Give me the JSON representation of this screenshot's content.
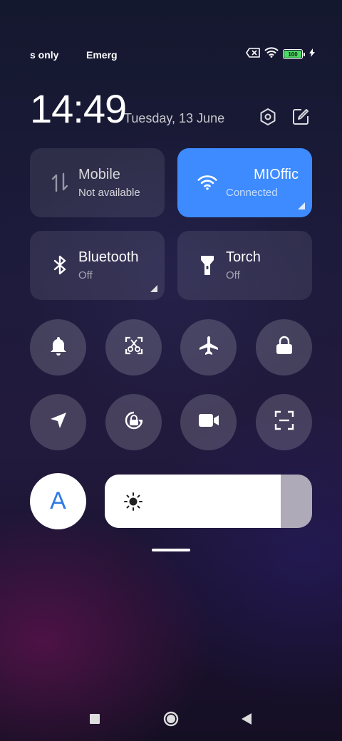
{
  "status_bar": {
    "carrier_left": "s only",
    "carrier_right": "Emerg",
    "battery_level": "100",
    "icons": [
      "no-sim-icon",
      "wifi-icon",
      "battery-icon",
      "charging-icon"
    ]
  },
  "header": {
    "time": "14:49",
    "date": "Tuesday, 13 June",
    "icons": [
      "settings-icon",
      "edit-icon"
    ]
  },
  "tiles": [
    {
      "title": "Mobile",
      "subtitle": "Not available",
      "icon": "mobile-data-icon",
      "active": false
    },
    {
      "title": "MIOffic",
      "subtitle": "Connected",
      "icon": "wifi-icon",
      "active": true
    },
    {
      "title": "Bluetooth",
      "subtitle": "Off",
      "icon": "bluetooth-icon",
      "active": false
    },
    {
      "title": "Torch",
      "subtitle": "Off",
      "icon": "torch-icon",
      "active": false
    }
  ],
  "toggles": [
    "bell-icon",
    "screenshot-icon",
    "airplane-icon",
    "lock-icon",
    "location-icon",
    "rotation-lock-icon",
    "screen-record-icon",
    "scanner-icon"
  ],
  "brightness": {
    "auto_label": "A",
    "level": 0.85,
    "icon": "sun-icon"
  },
  "nav_bar": [
    "recents-icon",
    "home-icon",
    "back-icon"
  ],
  "colors": {
    "accent": "#3d8bff",
    "auto_text": "#2f7ae5",
    "battery": "#4cd964"
  }
}
